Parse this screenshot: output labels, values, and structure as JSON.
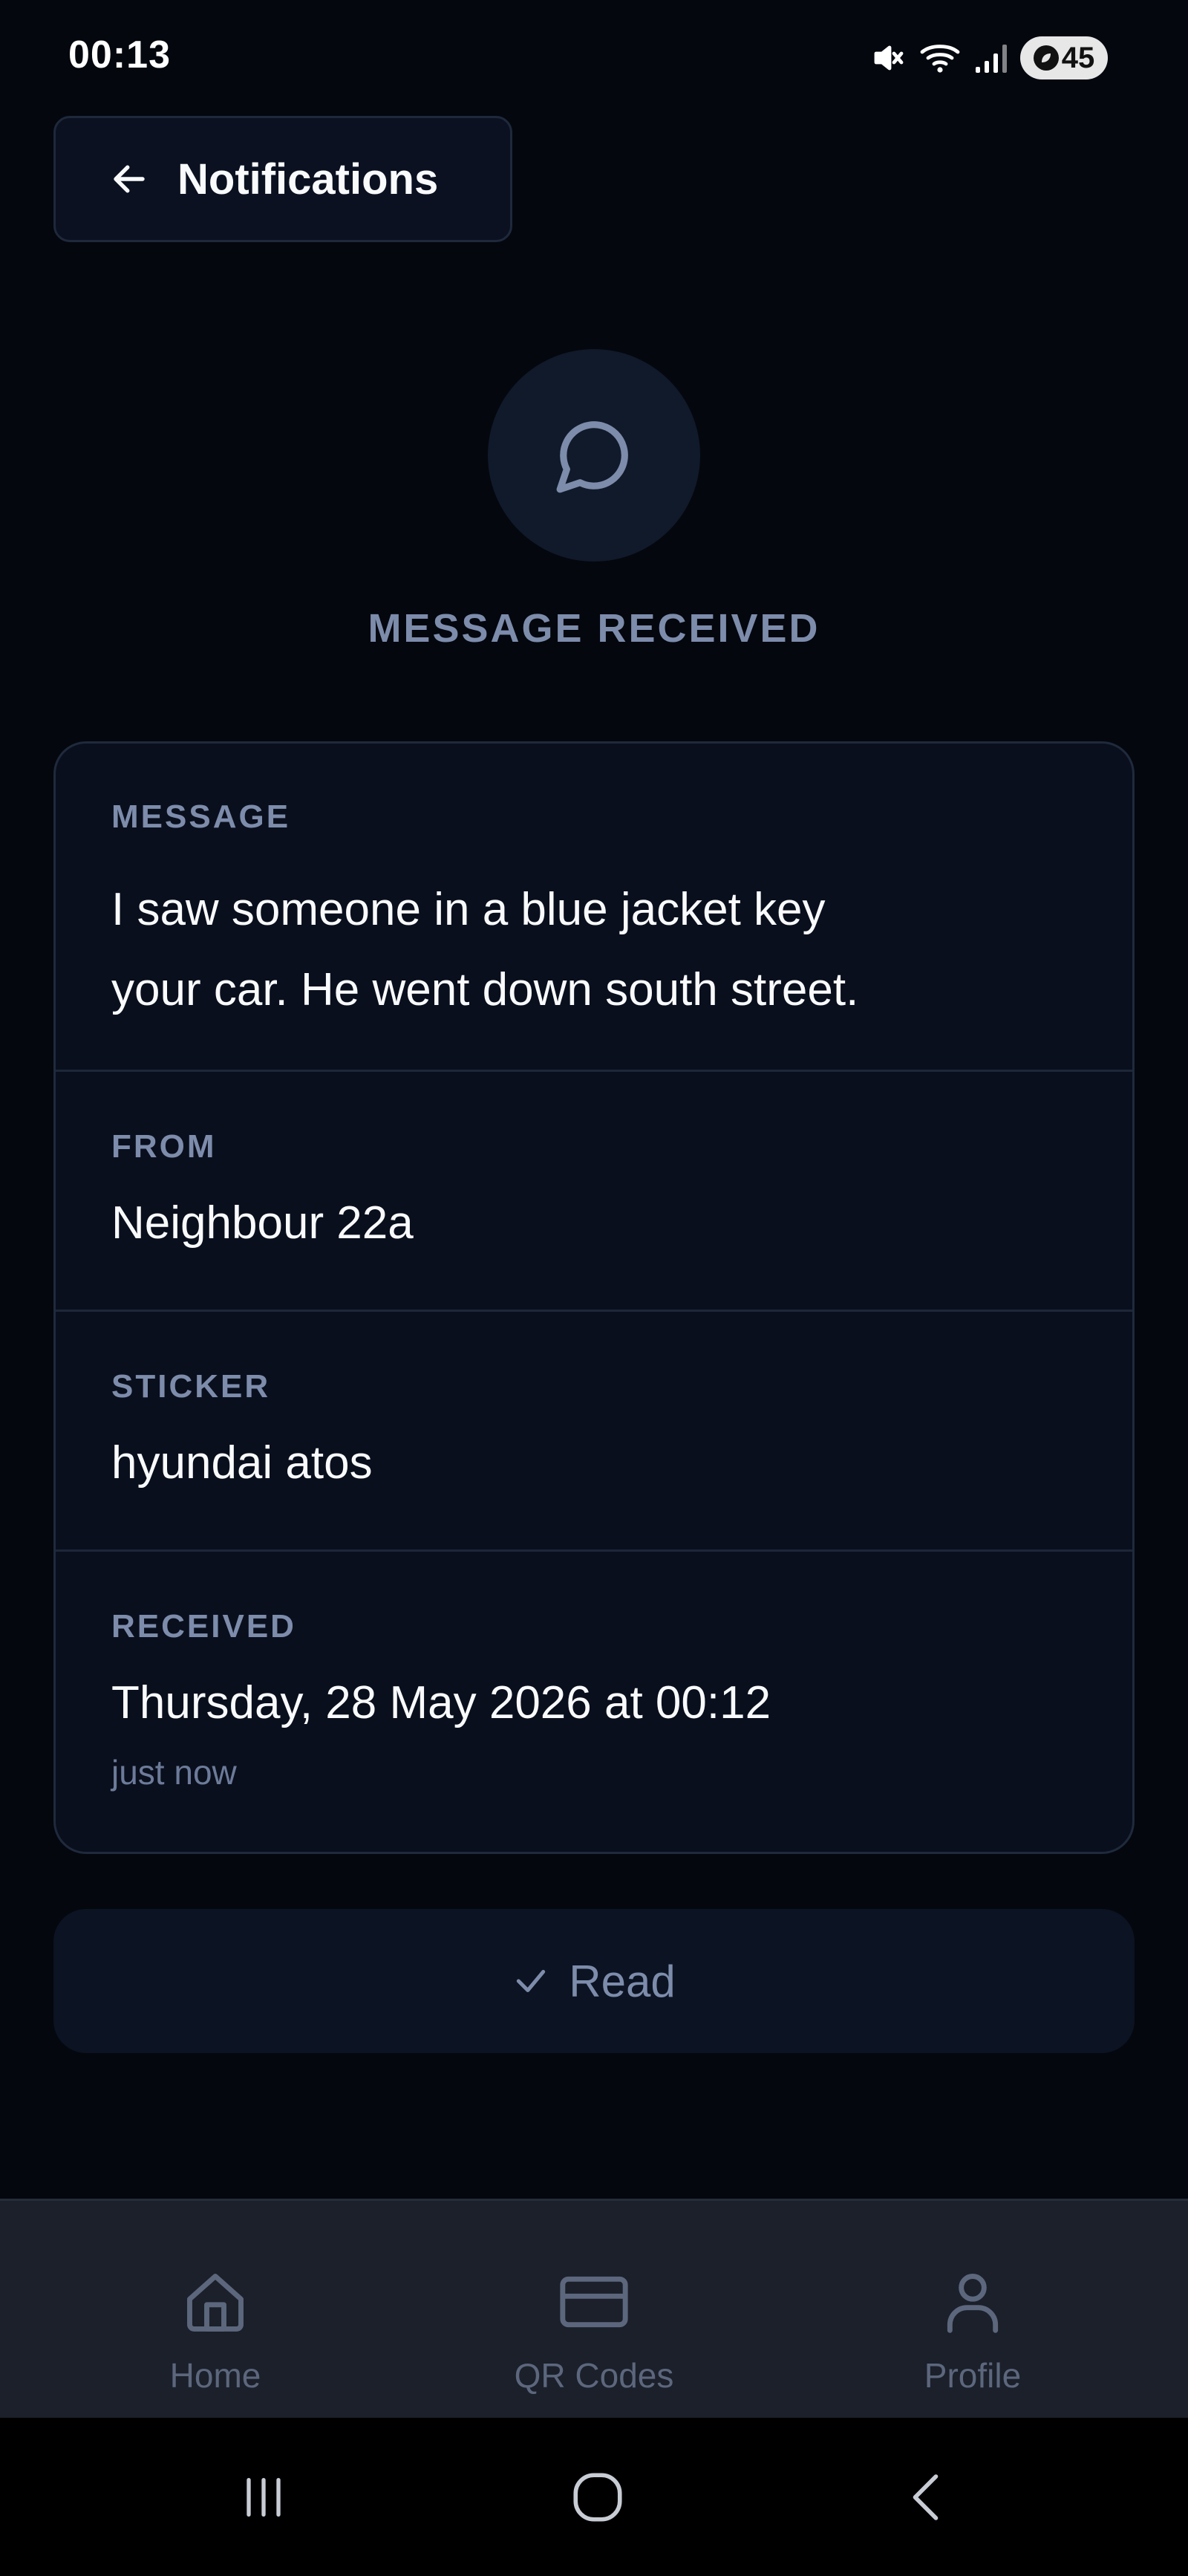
{
  "status_bar": {
    "time": "00:13",
    "battery": "45",
    "icons": [
      "mute-icon",
      "wifi-icon",
      "signal-icon",
      "battery-saver-icon"
    ]
  },
  "header": {
    "back_label": "Notifications",
    "title": "MESSAGE RECEIVED",
    "icon": "message-circle-icon"
  },
  "details": {
    "message": {
      "label": "MESSAGE",
      "line1": "I saw someone in a blue jacket key",
      "line2": "your car. He went down south street."
    },
    "from": {
      "label": "FROM",
      "value": "Neighbour 22a"
    },
    "sticker": {
      "label": "STICKER",
      "value": "hyundai atos"
    },
    "received": {
      "label": "RECEIVED",
      "value": "Thursday, 28 May 2026 at 00:12",
      "relative": "just now"
    }
  },
  "read_button": {
    "label": "Read",
    "icon": "check-icon"
  },
  "bottom_nav": {
    "items": [
      {
        "label": "Home",
        "icon": "home-icon"
      },
      {
        "label": "QR Codes",
        "icon": "card-icon"
      },
      {
        "label": "Profile",
        "icon": "user-icon"
      }
    ]
  },
  "system_nav": [
    "recent-apps-icon",
    "home-circle-icon",
    "back-chevron-icon"
  ],
  "colors": {
    "background": "#04070e",
    "card": "#0a0f1d",
    "muted_text": "#7d8cab",
    "primary_text": "#f8fafc",
    "nav_bar": "#1b202a"
  }
}
